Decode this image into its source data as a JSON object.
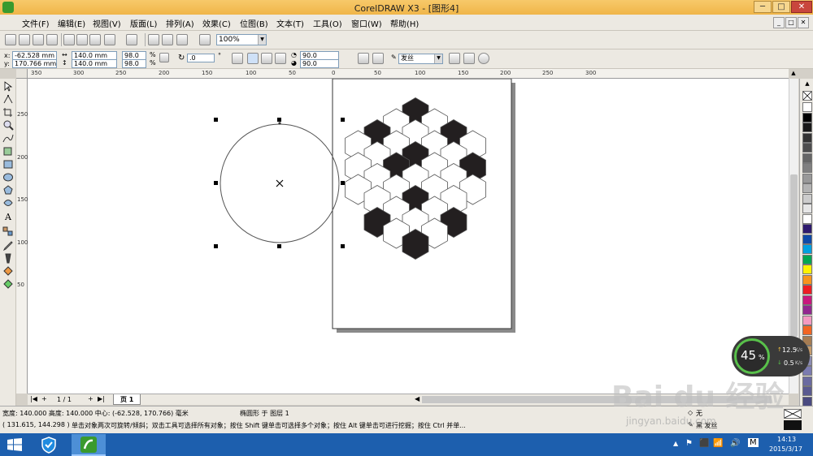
{
  "window": {
    "title": "CorelDRAW X3 - [图形4]",
    "btn_min": "─",
    "btn_max": "□",
    "btn_close": "✕",
    "mdi_min": "_",
    "mdi_restore": "□",
    "mdi_close": "✕"
  },
  "menu": [
    "文件(F)",
    "编辑(E)",
    "视图(V)",
    "版面(L)",
    "排列(A)",
    "效果(C)",
    "位图(B)",
    "文本(T)",
    "工具(O)",
    "窗口(W)",
    "帮助(H)"
  ],
  "toolbar": {
    "zoom": "100%"
  },
  "propbar": {
    "x_label": "x:",
    "x_value": "-62.528 mm",
    "y_label": "y:",
    "y_value": "170.766 mm",
    "width_value": "140.0 mm",
    "height_value": "140.0 mm",
    "scale_x": "98.0",
    "scale_y": "98.0",
    "pct": "%",
    "angle": ".0",
    "degree": "°",
    "start_angle": "90.0",
    "end_angle": "90.0",
    "outline": "发丝"
  },
  "ruler": {
    "h_ticks": [
      "350",
      "300",
      "250",
      "200",
      "150",
      "100",
      "50",
      "0",
      "50",
      "100",
      "150",
      "200",
      "250",
      "300"
    ],
    "v_ticks": [
      "250",
      "200",
      "150",
      "100",
      "50"
    ],
    "unit": "毫米"
  },
  "pager": {
    "count": "1 / 1",
    "tab": "页 1"
  },
  "status": {
    "dims": "宽度: 140.000  高度: 140.000  中心: (-62.528, 170.766)  毫米",
    "object_info": "椭圆形 于 图层 1",
    "cursor": "( 131.615, 144.298 )",
    "hint": "单击对象两次可旋转/倾斜；双击工具可选择所有对象；按住 Shift 键单击可选择多个对象；按住 Alt 键单击可进行挖掘；按住 Ctrl 并单...",
    "fill_label": "无",
    "outline_label": "黑 发丝"
  },
  "net": {
    "percent": "45",
    "percent_sign": "%",
    "up": "12.5",
    "down": "0.5",
    "unit": "K/s"
  },
  "taskbar": {
    "time": "14:13",
    "date": "2015/3/17",
    "ime": "M"
  },
  "watermark": {
    "main": "Bai du 经验",
    "sub": "jingyan.baidu.com"
  },
  "colors": {
    "hex_fill": "#231f20",
    "palette": [
      "#ffffff",
      "#000000",
      "#1a1a1a",
      "#333333",
      "#4d4d4d",
      "#666666",
      "#808080",
      "#999999",
      "#b3b3b3",
      "#cccccc",
      "#e6e6e6",
      "#ffffff",
      "#2e1a6e",
      "#0d4aa8",
      "#00a0e0",
      "#00a651",
      "#fff200",
      "#f7941d",
      "#ed1c24",
      "#c8187d",
      "#92278f",
      "#f49ac1",
      "#f26522",
      "#a67c52",
      "#c69c6d",
      "#8c8cb4",
      "#7b7bb0",
      "#6a6aa0",
      "#5a5a90",
      "#4a4a80"
    ]
  }
}
